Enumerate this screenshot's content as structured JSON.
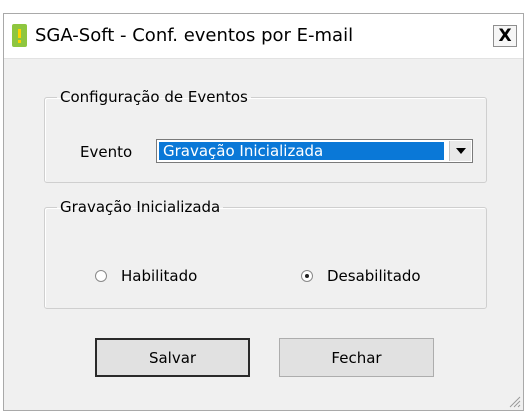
{
  "window": {
    "title": "SGA-Soft - Conf. eventos por E-mail",
    "close_label": "X"
  },
  "eventos_group": {
    "legend": "Configuração de Eventos",
    "evento_label": "Evento",
    "evento_selected": "Gravação Inicializada"
  },
  "gravacao_group": {
    "legend": "Gravação Inicializada",
    "options": [
      {
        "label": "Habilitado",
        "checked": false
      },
      {
        "label": "Desabilitado",
        "checked": true
      }
    ]
  },
  "buttons": {
    "save_label": "Salvar",
    "close_label": "Fechar"
  },
  "icons": {
    "app_icon": "app-icon",
    "close": "close-icon",
    "dropdown": "chevron-down-icon",
    "resize": "resize-grip-icon"
  },
  "colors": {
    "selection": "#0a78d7",
    "app_icon_green": "#8ec63f",
    "app_icon_yellow": "#ffd400"
  }
}
